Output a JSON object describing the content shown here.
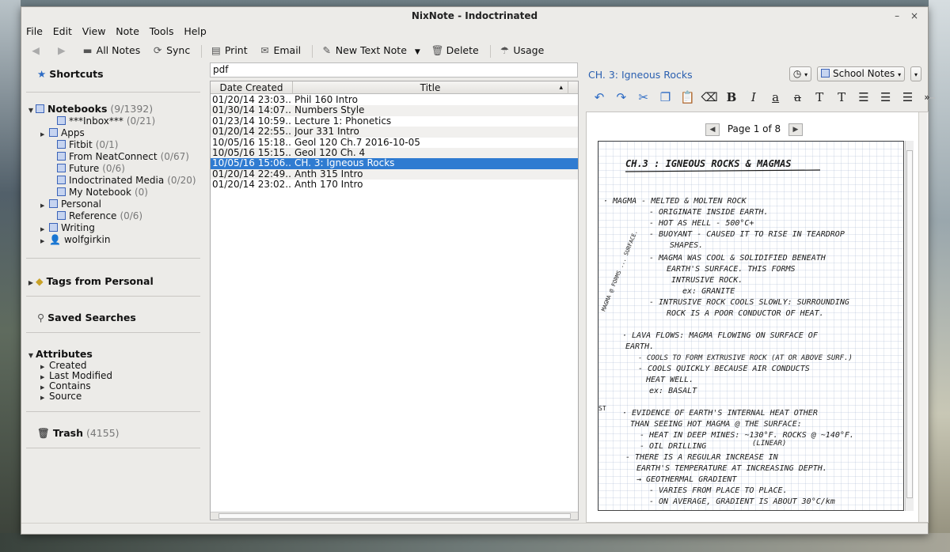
{
  "window": {
    "title": "NixNote - Indoctrinated",
    "minimize": "–",
    "close": "×"
  },
  "menu": [
    "File",
    "Edit",
    "View",
    "Note",
    "Tools",
    "Help"
  ],
  "toolbar": {
    "all_notes": "All Notes",
    "sync": "Sync",
    "print": "Print",
    "email": "Email",
    "new_text_note": "New Text Note",
    "delete": "Delete",
    "usage": "Usage"
  },
  "sidebar": {
    "shortcuts": "Shortcuts",
    "notebooks": {
      "label": "Notebooks",
      "count": "(9/1392)"
    },
    "notebook_items": [
      {
        "label": "***Inbox***",
        "count": "(0/21)",
        "expandable": false,
        "indent": 2,
        "type": "notebook"
      },
      {
        "label": "Apps",
        "count": "",
        "expandable": true,
        "indent": 1,
        "type": "stack"
      },
      {
        "label": "Fitbit",
        "count": "(0/1)",
        "expandable": false,
        "indent": 2,
        "type": "notebook"
      },
      {
        "label": "From NeatConnect",
        "count": "(0/67)",
        "expandable": false,
        "indent": 2,
        "type": "notebook"
      },
      {
        "label": "Future",
        "count": "(0/6)",
        "expandable": false,
        "indent": 2,
        "type": "notebook"
      },
      {
        "label": "Indoctrinated Media",
        "count": "(0/20)",
        "expandable": false,
        "indent": 2,
        "type": "notebook"
      },
      {
        "label": "My Notebook",
        "count": "(0)",
        "expandable": false,
        "indent": 2,
        "type": "notebook"
      },
      {
        "label": "Personal",
        "count": "",
        "expandable": true,
        "indent": 1,
        "type": "stack"
      },
      {
        "label": "Reference",
        "count": "(0/6)",
        "expandable": false,
        "indent": 2,
        "type": "notebook"
      },
      {
        "label": "Writing",
        "count": "",
        "expandable": true,
        "indent": 1,
        "type": "stack"
      },
      {
        "label": "wolfgirkin",
        "count": "",
        "expandable": true,
        "indent": 1,
        "type": "user"
      }
    ],
    "tags": "Tags from Personal",
    "saved_searches": "Saved Searches",
    "attributes": "Attributes",
    "attribute_items": [
      "Created",
      "Last Modified",
      "Contains",
      "Source"
    ],
    "trash": {
      "label": "Trash",
      "count": "(4155)"
    }
  },
  "filter": {
    "value": "pdf"
  },
  "note_list": {
    "columns": [
      "Date Created",
      "Title"
    ],
    "sort_indicator": "▴",
    "rows": [
      {
        "date": "01/20/14 23:03...",
        "title": "Phil 160 Intro",
        "selected": false
      },
      {
        "date": "01/30/14 14:07...",
        "title": "Numbers Style",
        "selected": false
      },
      {
        "date": "01/23/14 10:59...",
        "title": "Lecture 1: Phonetics",
        "selected": false
      },
      {
        "date": "01/20/14 22:55...",
        "title": "Jour 331 Intro",
        "selected": false
      },
      {
        "date": "10/05/16 15:18...",
        "title": "Geol 120 Ch.7 2016-10-05",
        "selected": false
      },
      {
        "date": "10/05/16 15:15...",
        "title": "Geol 120 Ch. 4",
        "selected": false
      },
      {
        "date": "10/05/16 15:06...",
        "title": "CH. 3: Igneous Rocks",
        "selected": true
      },
      {
        "date": "01/20/14 22:49...",
        "title": "Anth 315 Intro",
        "selected": false
      },
      {
        "date": "01/20/14 23:02...",
        "title": "Anth 170 Intro",
        "selected": false
      }
    ]
  },
  "editor": {
    "title": "CH. 3: Igneous Rocks",
    "notebook": "School Notes",
    "pager": "Page 1 of 8",
    "handwriting": [
      "CH.3 : IGNEOUS ROCKS & MAGMAS",
      "· MAGMA - MELTED & MOLTEN ROCK",
      "- ORIGINATE INSIDE EARTH.",
      "- HOT AS HELL - 500°C+",
      "- BUOYANT - CAUSED IT TO RISE IN TEARDROP",
      "SHAPES.",
      "- MAGMA WAS COOL & SOLIDIFIED BENEATH",
      "EARTH'S SURFACE. THIS FORMS",
      "INTRUSIVE ROCK.",
      "ex: GRANITE",
      "- INTRUSIVE ROCK COOLS SLOWLY: SURROUNDING",
      "ROCK IS A POOR CONDUCTOR OF HEAT.",
      "· LAVA FLOWS: MAGMA FLOWING ON SURFACE OF",
      "EARTH.",
      "- COOLS TO FORM EXTRUSIVE ROCK (AT OR ABOVE SURF.)",
      "- COOLS QUICKLY BECAUSE AIR CONDUCTS",
      "HEAT WELL.",
      "ex: BASALT",
      "· EVIDENCE OF EARTH'S INTERNAL HEAT OTHER",
      "THAN SEEING HOT MAGMA @ THE SURFACE:",
      "- HEAT IN DEEP MINES: ~130°F. ROCKS @ ~140°F.",
      "- OIL DRILLING",
      "(LINEAR)",
      "- THERE IS A REGULAR INCREASE IN",
      "EARTH'S TEMPERATURE AT INCREASING DEPTH.",
      "→ GEOTHERMAL GRADIENT",
      "- VARIES FROM PLACE TO PLACE.",
      "- ON AVERAGE, GRADIENT IS ABOUT 30°C/km"
    ],
    "margin_note": "MAGMA @ FORMS ... SURFACE.",
    "margin_left_mark": "ST"
  },
  "colors": {
    "selection": "#2f7bd1",
    "link": "#2a5fb0",
    "window_bg": "#ecebe8"
  }
}
